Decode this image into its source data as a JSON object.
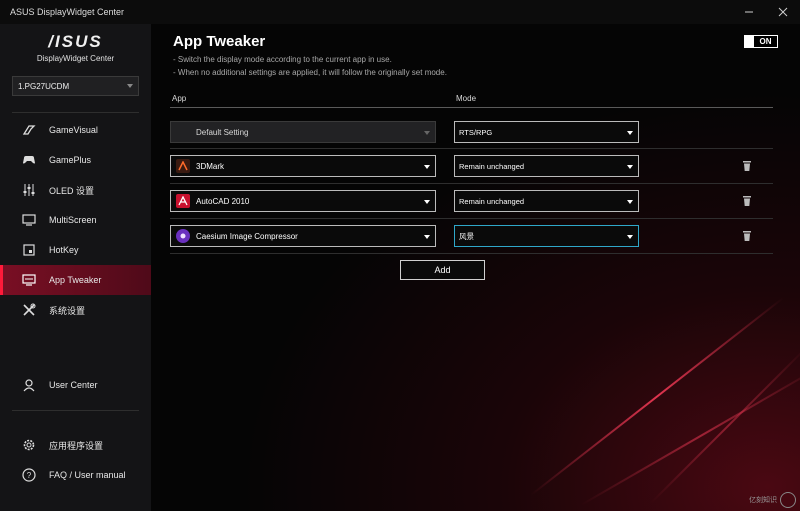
{
  "window": {
    "title": "ASUS DisplayWidget Center",
    "minimize_icon": "minimize-icon",
    "close_icon": "close-icon"
  },
  "sidebar": {
    "logo": "/ISUS",
    "logo_subtitle": "DisplayWidget Center",
    "monitor": "1.PG27UCDM",
    "items": [
      {
        "label": "GameVisual",
        "icon": "gamevisual-icon"
      },
      {
        "label": "GamePlus",
        "icon": "gamepad-icon"
      },
      {
        "label": "OLED 设置",
        "icon": "sliders-icon"
      },
      {
        "label": "MultiScreen",
        "icon": "monitor-icon"
      },
      {
        "label": "HotKey",
        "icon": "hotkey-icon"
      },
      {
        "label": "App Tweaker",
        "icon": "app-tweaker-icon",
        "active": true
      },
      {
        "label": "系统设置",
        "icon": "tools-icon"
      }
    ],
    "user_center": "User Center",
    "app_settings": "应用程序设置",
    "faq": "FAQ / User manual"
  },
  "main": {
    "title": "App Tweaker",
    "desc1": "- Switch the display mode according to the current app in use.",
    "desc2": "- When no additional settings are applied, it will follow the originally set mode.",
    "toggle": "ON",
    "col_app": "App",
    "col_mode": "Mode",
    "rows": [
      {
        "app": "Default Setting",
        "mode": "RTS/RPG",
        "disabled": true
      },
      {
        "app": "3DMark",
        "mode": "Remain unchanged"
      },
      {
        "app": "AutoCAD 2010",
        "mode": "Remain unchanged"
      },
      {
        "app": "Caesium Image Compressor",
        "mode": "风景",
        "focused": true
      }
    ],
    "add_label": "Add"
  },
  "watermark": "亿刻知识"
}
